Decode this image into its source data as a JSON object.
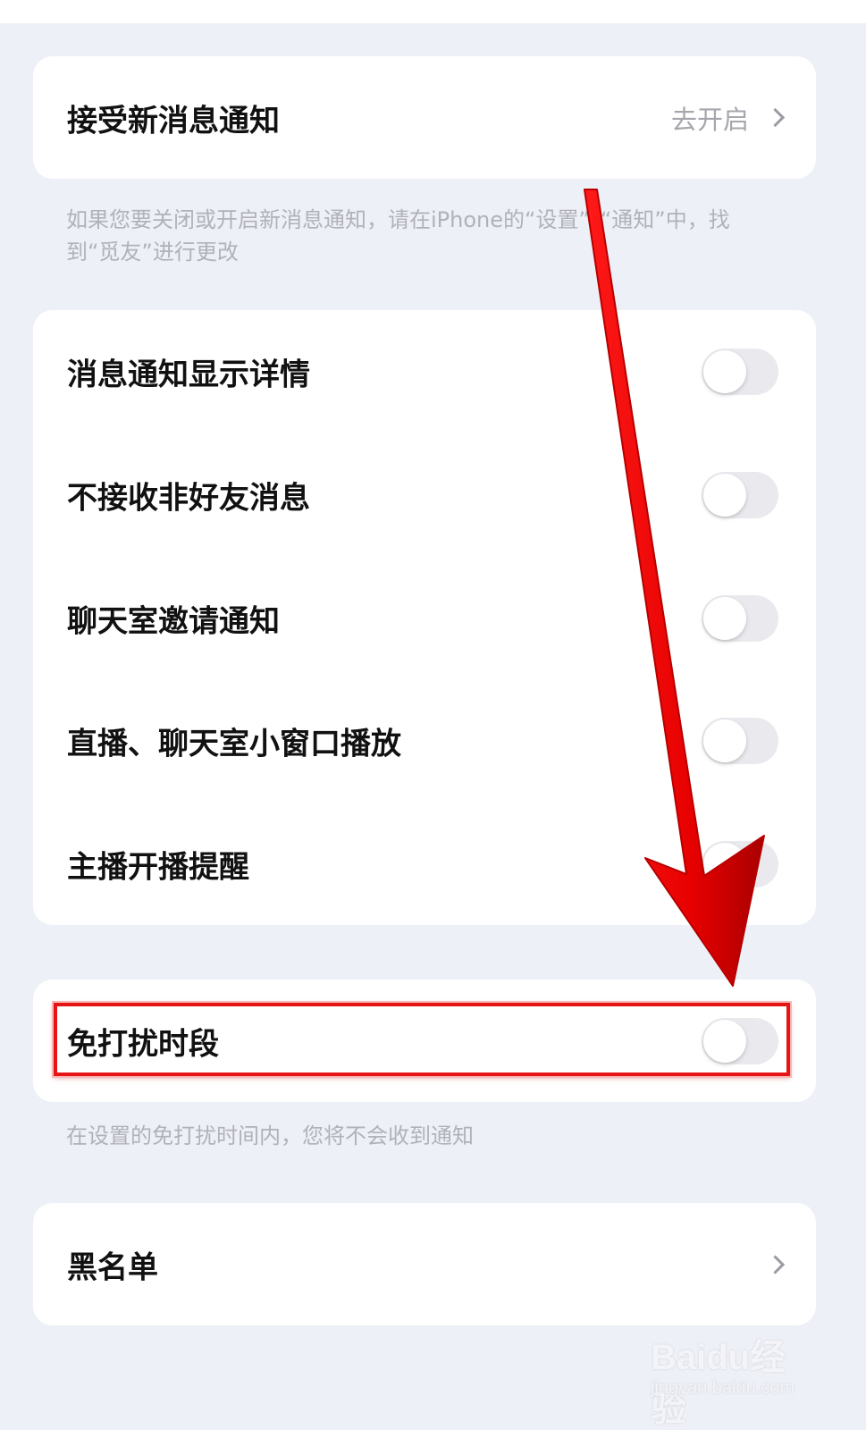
{
  "notification_card": {
    "label": "接受新消息通知",
    "action_label": "去开启"
  },
  "notification_hint": "如果您要关闭或开启新消息通知，请在iPhone的“设置”–“通知”中，找到“觅友”进行更改",
  "toggles_card": {
    "items": [
      {
        "label": "消息通知显示详情",
        "enabled": false
      },
      {
        "label": "不接收非好友消息",
        "enabled": false
      },
      {
        "label": "聊天室邀请通知",
        "enabled": false
      },
      {
        "label": "直播、聊天室小窗口播放",
        "enabled": false
      },
      {
        "label": "主播开播提醒",
        "enabled": false
      }
    ]
  },
  "dnd_card": {
    "label": "免打扰时段",
    "enabled": false
  },
  "dnd_hint": "在设置的免打扰时间内，您将不会收到通知",
  "blacklist_card": {
    "label": "黑名单"
  },
  "watermark": {
    "brand": "Baidu经验",
    "url": "jingyan.baidu.com"
  },
  "colors": {
    "background": "#eef0f7",
    "card": "#ffffff",
    "toggle_off": "#eaeaee",
    "annotation_red": "#e51515"
  }
}
